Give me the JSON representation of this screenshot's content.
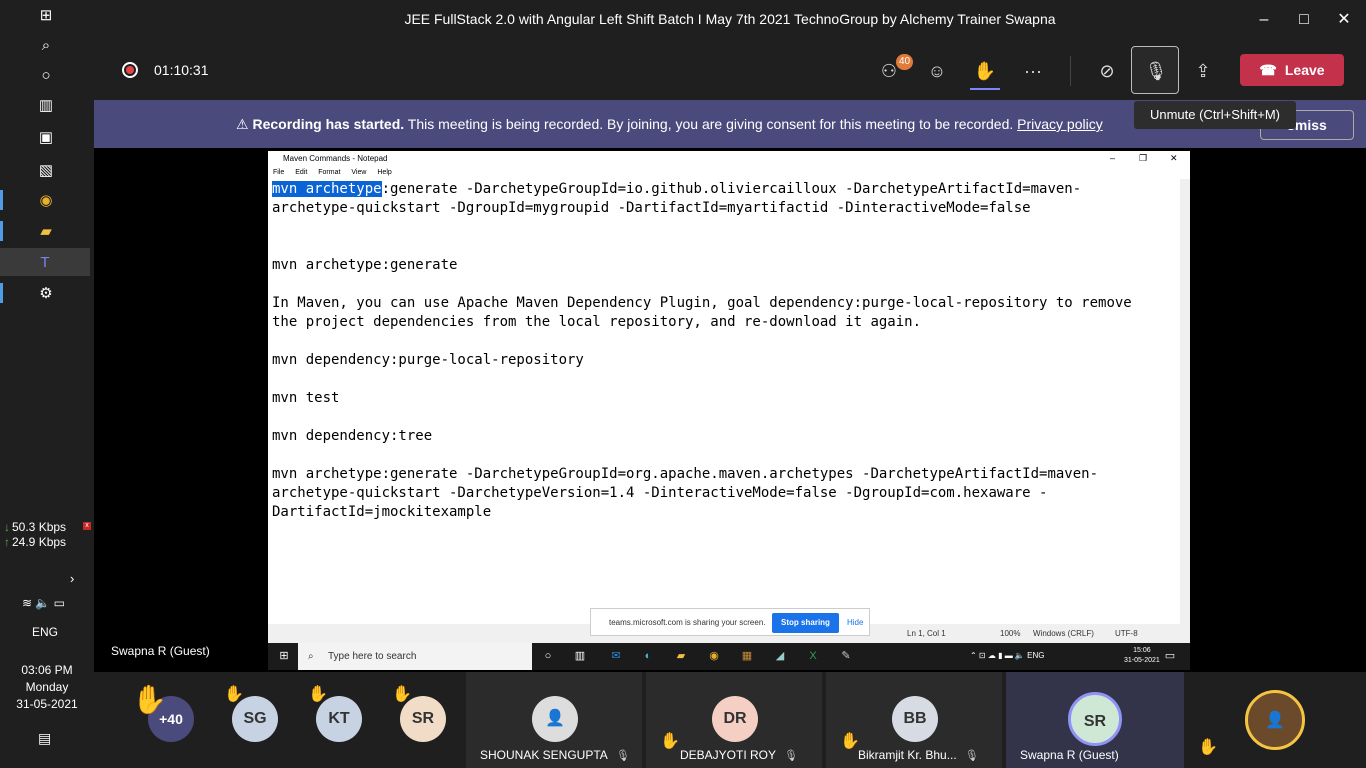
{
  "window": {
    "title": "JEE FullStack 2.0 with Angular Left Shift Batch I May 7th 2021 TechnoGroup by Alchemy Trainer Swapna"
  },
  "toolbar": {
    "timer": "01:10:31",
    "participants_badge": "40",
    "leave_label": "Leave",
    "unmute_tooltip": "Unmute (Ctrl+Shift+M)"
  },
  "banner": {
    "bold": "Recording has started.",
    "text": "This meeting is being recorded. By joining, you are giving consent for this meeting to be recorded.",
    "link": "Privacy policy",
    "dismiss": "smiss"
  },
  "notepad": {
    "title": "Maven Commands - Notepad",
    "menu": [
      "File",
      "Edit",
      "Format",
      "View",
      "Help"
    ],
    "selected": "mvn archetype",
    "line1_rest": ":generate -DarchetypeGroupId=io.github.oliviercailloux -DarchetypeArtifactId=maven-\narchetype-quickstart -DgroupId=mygroupid -DartifactId=myartifactid -DinteractiveMode=false\n\n\nmvn archetype:generate\n\nIn Maven, you can use Apache Maven Dependency Plugin, goal dependency:purge-local-repository to remove\nthe project dependencies from the local repository, and re-download it again.\n\nmvn dependency:purge-local-repository\n\nmvn test\n\nmvn dependency:tree\n\nmvn archetype:generate -DarchetypeGroupId=org.apache.maven.archetypes -DarchetypeArtifactId=maven-\narchetype-quickstart -DarchetypeVersion=1.4 -DinteractiveMode=false -DgroupId=com.hexaware -\nDartifactId=jmockitexample",
    "status": {
      "pos": "Ln 1, Col 1",
      "zoom": "100%",
      "eol": "Windows (CRLF)",
      "enc": "UTF-8"
    }
  },
  "share_pill": {
    "text": "teams.microsoft.com is sharing your screen.",
    "stop": "Stop sharing",
    "hide": "Hide"
  },
  "inner_taskbar": {
    "search": "Type here to search",
    "lang": "ENG",
    "time": "15:06",
    "date": "31-05-2021"
  },
  "presenter_name": "Swapna R (Guest)",
  "left_taskbar": {
    "down": "50.3 Kbps",
    "up": "24.9 Kbps",
    "lang": "ENG",
    "time": "03:06 PM",
    "day": "Monday",
    "date": "31-05-2021"
  },
  "participants": {
    "more": "+40",
    "avatars": [
      "SG",
      "KT",
      "SR"
    ],
    "tiles": [
      {
        "name": "SHOUNAK SENGUPTA"
      },
      {
        "initials": "DR",
        "name": "DEBAJYOTI ROY"
      },
      {
        "initials": "BB",
        "name": "Bikramjit Kr. Bhu..."
      },
      {
        "initials": "SR",
        "name": "Swapna R (Guest)"
      }
    ]
  }
}
